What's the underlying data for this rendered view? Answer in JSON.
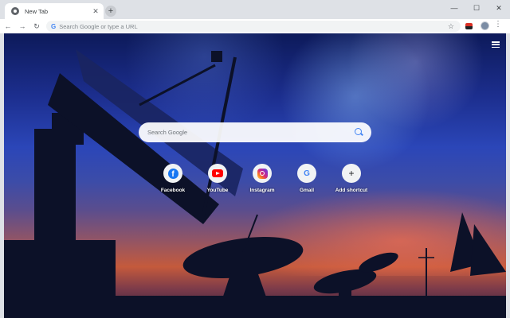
{
  "browser": {
    "tab": {
      "title": "New Tab",
      "close_glyph": "✕"
    },
    "new_tab_glyph": "+",
    "window_controls": {
      "minimize": "—",
      "maximize": "☐",
      "close": "✕"
    },
    "nav": {
      "back": "←",
      "forward": "→",
      "reload": "↻"
    },
    "omnibox": {
      "logo": "G",
      "placeholder": "Search Google or type a URL",
      "star": "☆"
    },
    "menu": "⋮"
  },
  "newtab": {
    "search": {
      "placeholder": "Search Google"
    },
    "shortcuts": [
      {
        "label": "Facebook",
        "icon": "facebook-icon"
      },
      {
        "label": "YouTube",
        "icon": "youtube-icon"
      },
      {
        "label": "Instagram",
        "icon": "instagram-icon"
      },
      {
        "label": "Gmail",
        "icon": "google-icon",
        "glyph": "G"
      },
      {
        "label": "Add shortcut",
        "icon": "add-icon",
        "glyph": "+"
      }
    ]
  }
}
